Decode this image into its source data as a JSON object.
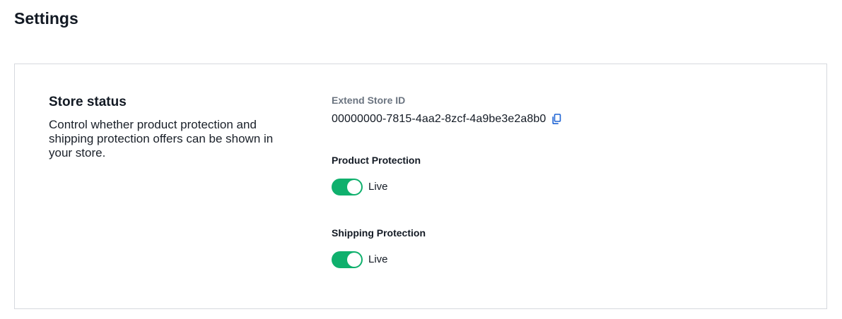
{
  "page": {
    "title": "Settings"
  },
  "store_status": {
    "title": "Store status",
    "description": "Control whether product protection and shipping protection offers can be shown in your store.",
    "store_id_label": "Extend Store ID",
    "store_id_value": "00000000-7815-4aa2-8zcf-4a9be3e2a8b0",
    "copy_icon": "copy-icon",
    "product_protection": {
      "label": "Product Protection",
      "enabled": true,
      "status_text": "Live"
    },
    "shipping_protection": {
      "label": "Shipping Protection",
      "enabled": true,
      "status_text": "Live"
    }
  },
  "colors": {
    "toggle_on": "#0fb06d",
    "link_blue": "#1d63d4",
    "muted_label": "#6b7480",
    "border": "#d6d9de"
  }
}
